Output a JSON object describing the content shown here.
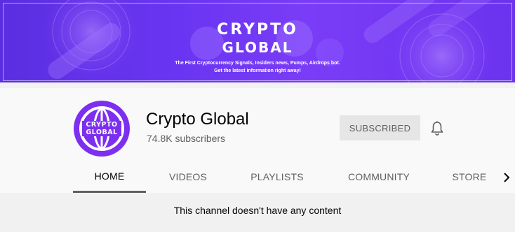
{
  "banner": {
    "title_line1": "CRYPTO",
    "title_line2": "GLOBAL",
    "tagline": "The First Cryptocurrency Signals, Insiders news, Pumps, Airdrops bot.",
    "subline": "Get the latest information right away!",
    "colors": {
      "background": "#6a35f2",
      "accent": "#ffffff"
    }
  },
  "channel": {
    "avatar_line1": "CRYPTO",
    "avatar_line2": "GLOBAL",
    "name": "Crypto Global",
    "subscribers": "74.8K subscribers",
    "subscribe_label": "SUBSCRIBED",
    "bell_icon": "bell-icon"
  },
  "tabs": [
    {
      "label": "HOME",
      "active": true
    },
    {
      "label": "VIDEOS",
      "active": false
    },
    {
      "label": "PLAYLISTS",
      "active": false
    },
    {
      "label": "COMMUNITY",
      "active": false
    },
    {
      "label": "STORE",
      "active": false
    }
  ],
  "tabs_more_icon": "chevron-right-icon",
  "content": {
    "empty_message": "This channel doesn't have any content"
  }
}
